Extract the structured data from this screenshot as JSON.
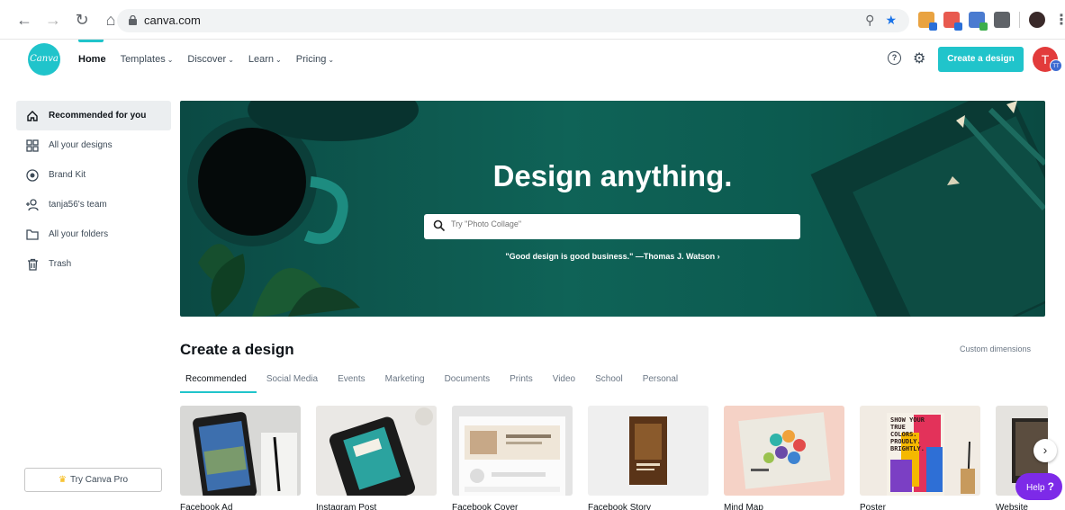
{
  "browser": {
    "url": "canva.com"
  },
  "header": {
    "logo_text": "Canva",
    "menu": [
      {
        "label": "Home",
        "caret": ""
      },
      {
        "label": "Templates",
        "caret": "⌄"
      },
      {
        "label": "Discover",
        "caret": "⌄"
      },
      {
        "label": "Learn",
        "caret": "⌄"
      },
      {
        "label": "Pricing",
        "caret": "⌄"
      }
    ],
    "help_symbol": "?",
    "create_button": "Create a design",
    "avatar_letter": "T",
    "avatar_team_letters": "TT"
  },
  "sidebar": {
    "items": [
      {
        "label": "Recommended for you",
        "icon": "home-icon"
      },
      {
        "label": "All your designs",
        "icon": "grid-icon"
      },
      {
        "label": "Brand Kit",
        "icon": "brand-kit-icon"
      },
      {
        "label": "tanja56's team",
        "icon": "team-icon"
      },
      {
        "label": "All your folders",
        "icon": "folder-icon"
      },
      {
        "label": "Trash",
        "icon": "trash-icon"
      }
    ],
    "try_pro": "Try Canva Pro"
  },
  "hero": {
    "title": "Design anything.",
    "search_placeholder": "Try \"Photo Collage\"",
    "quote": "\"Good design is good business.\" —Thomas J. Watson ›"
  },
  "create": {
    "title": "Create a design",
    "custom_dimensions": "Custom dimensions",
    "tabs": [
      "Recommended",
      "Social Media",
      "Events",
      "Marketing",
      "Documents",
      "Prints",
      "Video",
      "School",
      "Personal"
    ],
    "cards": [
      {
        "label": "Facebook Ad"
      },
      {
        "label": "Instagram Post"
      },
      {
        "label": "Facebook Cover"
      },
      {
        "label": "Facebook Story"
      },
      {
        "label": "Mind Map"
      },
      {
        "label": "Poster"
      },
      {
        "label": "Website"
      }
    ],
    "poster_text": "SHOW YOUR TRUE COLORS. PROUDLY. BRIGHTLY."
  },
  "help_button": {
    "label": "Help",
    "symbol": "?"
  },
  "colors": {
    "accent": "#20c4cb",
    "help": "#7d2ae8",
    "avatar": "#e23b3b",
    "hero": "#0f6357"
  }
}
